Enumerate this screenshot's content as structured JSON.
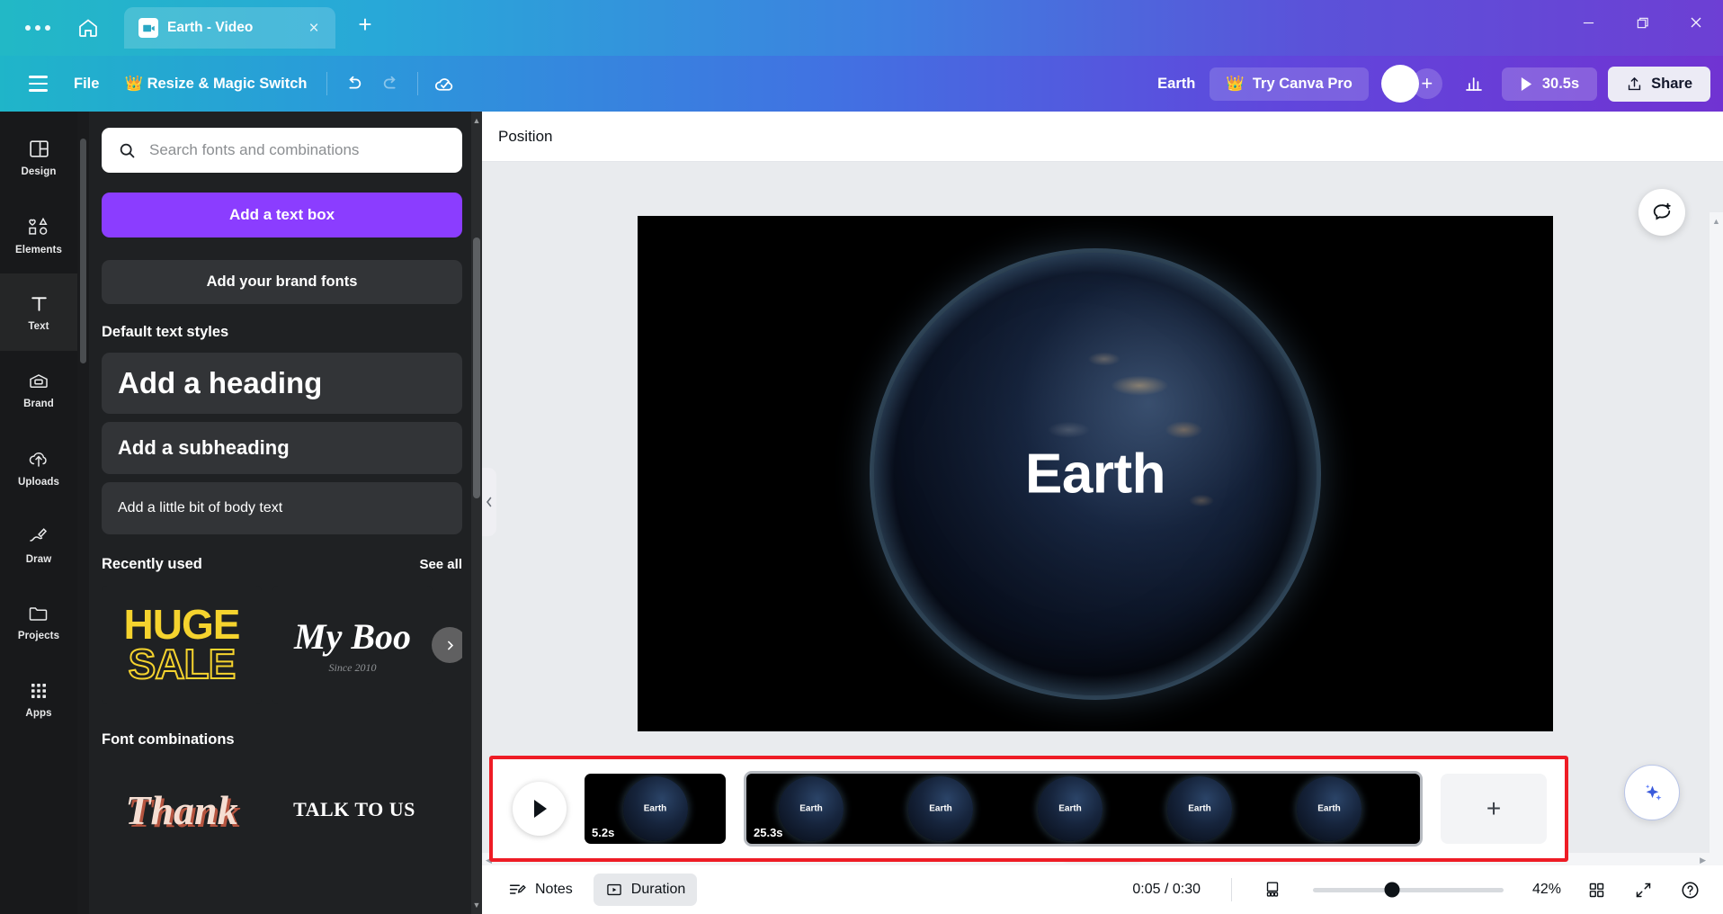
{
  "titlebar": {
    "tab": {
      "title": "Earth - Video",
      "favicon_icon": "video-camera-icon",
      "close_icon": "close-icon"
    },
    "overflow_icon": "more-options-icon",
    "home_icon": "home-icon",
    "new_tab_icon": "plus-icon",
    "window": {
      "minimize_icon": "minimize-icon",
      "maximize_icon": "maximize-icon",
      "close_icon": "close-icon"
    }
  },
  "header": {
    "menu_icon": "hamburger-menu-icon",
    "file_label": "File",
    "resize_label": "Resize & Magic Switch",
    "resize_icon": "crown-icon",
    "undo_icon": "undo-icon",
    "redo_icon": "redo-icon",
    "cloud_saved_icon": "cloud-check-icon",
    "doc_title": "Earth",
    "pro_label": "Try Canva Pro",
    "pro_icon": "crown-icon",
    "avatar_name": "avatar",
    "add_member_icon": "plus-icon",
    "insights_icon": "bar-chart-icon",
    "play_icon": "play-icon",
    "duration_label": "30.5s",
    "share_label": "Share",
    "share_icon": "upload-icon"
  },
  "rail": {
    "items": [
      {
        "label": "Design",
        "icon": "layout-icon",
        "active": false
      },
      {
        "label": "Elements",
        "icon": "shapes-icon",
        "active": false
      },
      {
        "label": "Text",
        "icon": "text-t-icon",
        "active": true
      },
      {
        "label": "Brand",
        "icon": "brand-card-icon",
        "active": false
      },
      {
        "label": "Uploads",
        "icon": "cloud-upload-icon",
        "active": false
      },
      {
        "label": "Draw",
        "icon": "pen-icon",
        "active": false
      },
      {
        "label": "Projects",
        "icon": "folder-icon",
        "active": false
      },
      {
        "label": "Apps",
        "icon": "grid-dots-icon",
        "active": false
      }
    ]
  },
  "panel": {
    "search": {
      "placeholder": "Search fonts and combinations",
      "value": "",
      "icon": "search-icon"
    },
    "add_text_box_label": "Add a text box",
    "add_brand_fonts_label": "Add your brand fonts",
    "default_styles_title": "Default text styles",
    "styles": [
      {
        "label": "Add a heading"
      },
      {
        "label": "Add a subheading"
      },
      {
        "label": "Add a little bit of body text"
      }
    ],
    "recently_used_title": "Recently used",
    "see_all_label": "See all",
    "recent_items": [
      {
        "line1": "HUGE",
        "line2": "SALE"
      },
      {
        "line1": "My Boo",
        "line2": "Since 2010"
      }
    ],
    "carousel_next_icon": "chevron-right-icon",
    "font_combinations_title": "Font combinations",
    "combination_items": [
      {
        "label": "Thank"
      },
      {
        "label": "TALK TO US"
      }
    ]
  },
  "main": {
    "position_label": "Position",
    "canvas": {
      "title": "Earth"
    },
    "comment_icon": "add-comment-icon",
    "magic_icon": "magic-sparkle-icon",
    "page_collapse_icon": "chevron-down-icon",
    "panel_collapse_icon": "chevron-left-icon"
  },
  "timeline": {
    "play_icon": "play-icon",
    "clips": [
      {
        "duration": "5.2s",
        "label": "Earth",
        "selected": false,
        "frames": 1
      },
      {
        "duration": "25.3s",
        "label": "Earth",
        "selected": true,
        "frames": 5
      }
    ],
    "add_page_icon": "plus-icon"
  },
  "statusbar": {
    "notes_label": "Notes",
    "notes_icon": "notes-icon",
    "duration_label": "Duration",
    "duration_icon": "duration-play-icon",
    "time_display": "0:05 / 0:30",
    "fit_icon": "fit-page-icon",
    "zoom_value": "42%",
    "grid_icon": "grid-view-icon",
    "fullscreen_icon": "expand-icon",
    "help_icon": "help-circle-icon"
  },
  "colors": {
    "brand_purple": "#8b3dff",
    "timeline_highlight": "#ee1c25",
    "panel_bg": "#1f2123",
    "rail_bg": "#18191b"
  }
}
